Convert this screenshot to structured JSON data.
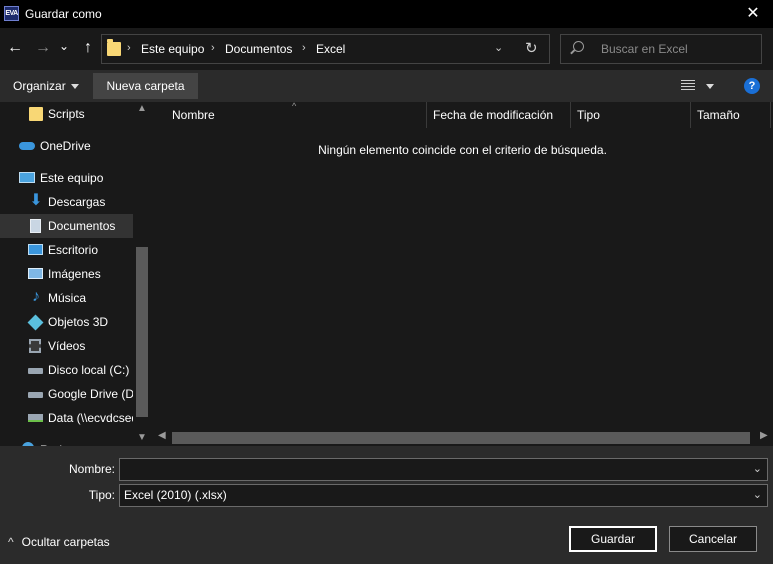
{
  "window": {
    "title": "Guardar como",
    "app_icon_text": "EVA",
    "close_glyph": "✕"
  },
  "nav": {
    "back_glyph": "←",
    "forward_glyph": "→",
    "recent_glyph": "⌄",
    "up_glyph": "↑",
    "breadcrumbs": [
      "Este equipo",
      "Documentos",
      "Excel"
    ],
    "separator": "›",
    "refresh_glyph": "↻",
    "dropdown_glyph": "⌄"
  },
  "search": {
    "placeholder": "Buscar en Excel"
  },
  "toolbar": {
    "organize_label": "Organizar",
    "new_folder_label": "Nueva carpeta",
    "help_label": "?"
  },
  "sidebar": {
    "items": [
      {
        "label": "Scripts",
        "icon": "folder-icon",
        "color": "#f8d775"
      },
      {
        "label": "OneDrive",
        "icon": "cloud-icon",
        "color": "#3a96dd"
      },
      {
        "label": "Este equipo",
        "icon": "computer-icon",
        "color": "#4aa3df"
      },
      {
        "label": "Descargas",
        "icon": "download-icon",
        "color": "#3a96dd"
      },
      {
        "label": "Documentos",
        "icon": "document-icon",
        "color": "#c9d6e3",
        "selected": true
      },
      {
        "label": "Escritorio",
        "icon": "desktop-icon",
        "color": "#3a96dd"
      },
      {
        "label": "Imágenes",
        "icon": "pictures-icon",
        "color": "#7fb7e5"
      },
      {
        "label": "Música",
        "icon": "music-icon",
        "color": "#3a96dd"
      },
      {
        "label": "Objetos 3D",
        "icon": "cube-icon",
        "color": "#5bc0de"
      },
      {
        "label": "Vídeos",
        "icon": "video-icon",
        "color": "#9aa6b2"
      },
      {
        "label": "Disco local (C:)",
        "icon": "drive-icon",
        "color": "#9aa6b2"
      },
      {
        "label": "Google Drive (D:",
        "icon": "drive-icon",
        "color": "#9aa6b2"
      },
      {
        "label": "Data (\\\\ecvdcsed",
        "icon": "network-drive-icon",
        "color": "#6cc04a"
      },
      {
        "label": "Red",
        "icon": "network-icon",
        "color": "#4aa3df"
      }
    ]
  },
  "filelist": {
    "columns": [
      "Nombre",
      "Fecha de modificación",
      "Tipo",
      "Tamaño"
    ],
    "empty_message": "Ningún elemento coincide con el criterio de búsqueda."
  },
  "form": {
    "name_label": "Nombre:",
    "name_value": "",
    "type_label": "Tipo:",
    "type_value": "Excel (2010) (.xlsx)"
  },
  "footer": {
    "hide_folders_label": "Ocultar carpetas",
    "save_label": "Guardar",
    "cancel_label": "Cancelar"
  },
  "colors": {
    "accent": "#1a6fd6",
    "folder": "#f8d775",
    "background": "#191919",
    "panel": "#2b2b2b"
  }
}
